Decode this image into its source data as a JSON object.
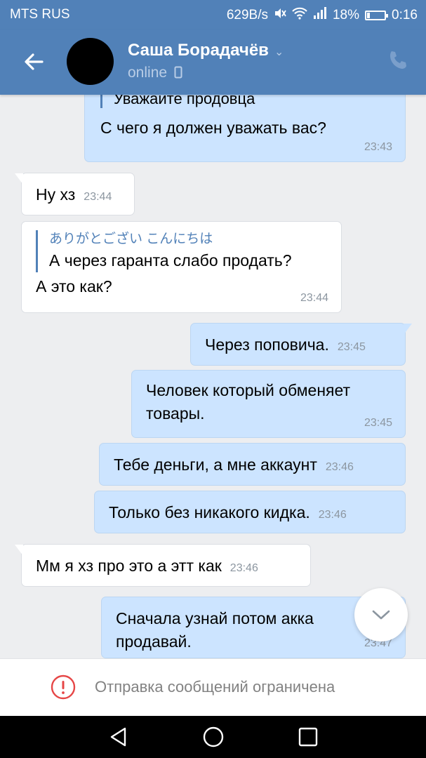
{
  "status_bar": {
    "carrier": "MTS RUS",
    "speed": "629B/s",
    "battery": "18%",
    "battery_level": 0.18,
    "time": "0:16"
  },
  "header": {
    "contact_name": "Саша Борадачёв",
    "status": "online"
  },
  "messages": [
    {
      "dir": "out",
      "quote": "Уважаите продовца",
      "text": "С чего я должен уважать вас?",
      "time": "23:43"
    },
    {
      "dir": "in",
      "text": "Ну хз",
      "time": "23:44"
    },
    {
      "dir": "in",
      "quote_name": "ありがとござい こんにちは",
      "quote": "А через гаранта слабо продать?",
      "text": "А это как?",
      "time": "23:44"
    },
    {
      "dir": "out",
      "text": "Через поповича.",
      "time": "23:45"
    },
    {
      "dir": "out",
      "text_lines": [
        "Человек который обменяет",
        "товары."
      ],
      "time": "23:45"
    },
    {
      "dir": "out",
      "text": "Тебе деньги, а мне аккаунт",
      "time": "23:46"
    },
    {
      "dir": "out",
      "text": "Только без никакого кидка.",
      "time": "23:46"
    },
    {
      "dir": "in",
      "text": "Мм я хз про это а этт как",
      "time": "23:46"
    },
    {
      "dir": "out",
      "text_lines": [
        "Сначала узнай потом акка",
        "продавай."
      ],
      "time": "23:47"
    }
  ],
  "footer": {
    "restriction_text": "Отправка сообщений ограничена"
  },
  "colors": {
    "header": "#5181b8",
    "outgoing_bubble": "#cce4ff",
    "incoming_bubble": "#ffffff",
    "background": "#edeef0",
    "warning": "#e64646"
  }
}
